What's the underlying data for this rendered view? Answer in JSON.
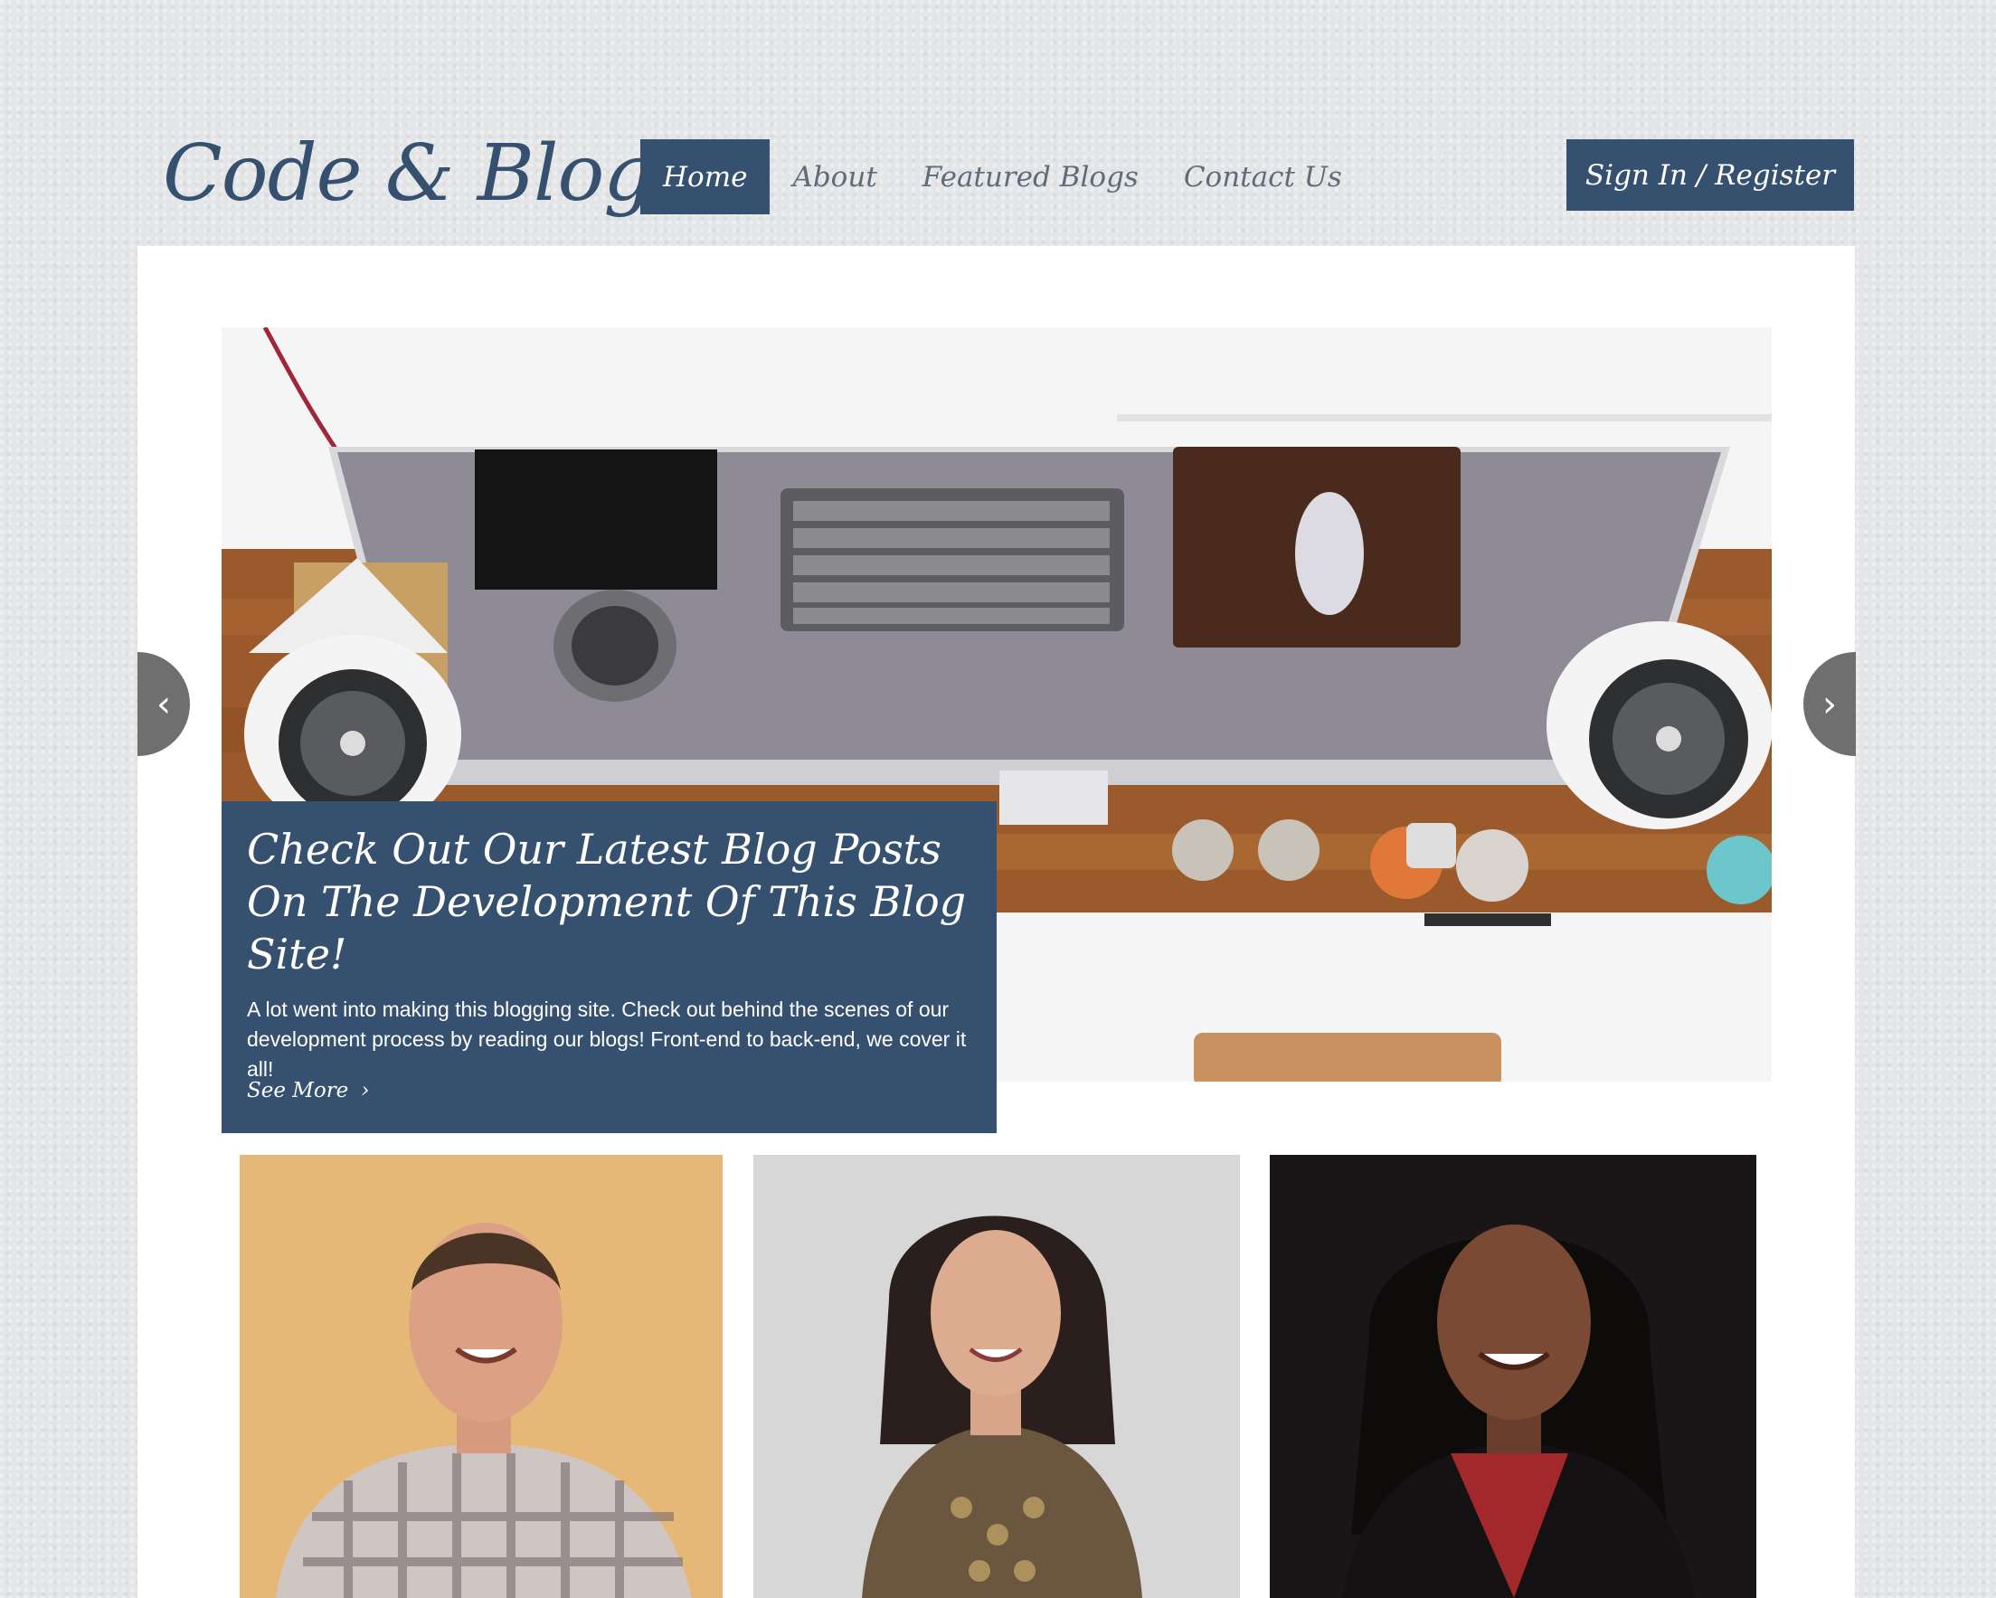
{
  "logo": "Code & Blog",
  "nav": {
    "home": "Home",
    "about": "About",
    "featured": "Featured Blogs",
    "contact": "Contact Us"
  },
  "signin_label": "Sign In / Register",
  "hero": {
    "title": "Check Out Our Latest Blog Posts On The Development Of This Blog Site!",
    "body": "A lot went into making this blogging site. Check out behind the scenes of our development process by reading our blogs! Front-end to back-end, we cover it all!",
    "cta": "See More"
  },
  "colors": {
    "brand": "#36506f",
    "background": "#e4e5e7",
    "panel": "#ffffff"
  },
  "icons": {
    "prev": "chevron-left-icon",
    "next": "chevron-right-icon",
    "cta": "chevron-right-icon"
  }
}
